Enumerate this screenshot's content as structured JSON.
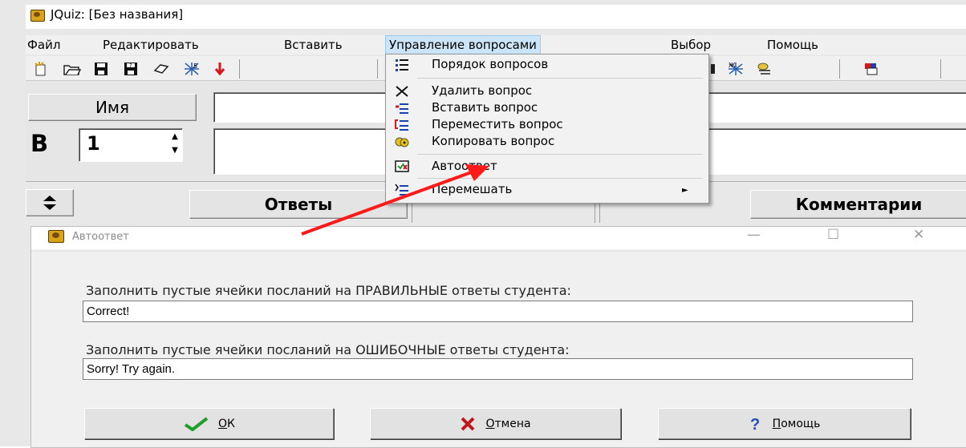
{
  "window": {
    "title": "JQuiz: [Без названия]"
  },
  "menubar": {
    "items": [
      "Файл",
      "Редактировать",
      "Вставить",
      "Управление вопросами",
      "Выбор",
      "Помощь"
    ]
  },
  "form": {
    "name_label": "Имя",
    "question_label": "В",
    "question_number": "1",
    "spin_up": "▲",
    "spin_down": "▼",
    "answers_label": "Ответы",
    "comments_label": "Комментарии"
  },
  "dropdown": {
    "items": [
      {
        "label": "Порядок вопросов",
        "icon": "list-order-icon"
      },
      {
        "label": "Удалить вопрос",
        "icon": "delete-x-icon"
      },
      {
        "label": "Вставить вопрос",
        "icon": "insert-question-icon"
      },
      {
        "label": "Переместить вопрос",
        "icon": "move-question-icon"
      },
      {
        "label": "Копировать вопрос",
        "icon": "copy-question-icon"
      },
      {
        "label": "Автоответ",
        "icon": "autoanswer-icon"
      },
      {
        "label": "Перемешать",
        "icon": "shuffle-icon",
        "submenu_arrow": "►"
      }
    ]
  },
  "dialog": {
    "title": "Автоответ",
    "minimize": "—",
    "maximize": "☐",
    "close": "✕",
    "correct_label": "Заполнить пустые ячейки посланий на ПРАВИЛЬНЫЕ ответы студента:",
    "correct_value": "Correct!",
    "wrong_label": "Заполнить пустые ячейки посланий на ОШИБОЧНЫЕ ответы студента:",
    "wrong_value": "Sorry! Try again.",
    "ok_accel": "О",
    "ok_rest": "К",
    "cancel_accel": "О",
    "cancel_rest": "тмена",
    "help_accel": "П",
    "help_rest": "омощь"
  },
  "colors": {
    "menu_highlight": "#cce4f7",
    "arrow": "#ff1a1a",
    "ok_check": "#1f9e2a",
    "cancel_x": "#c0161c",
    "help_q": "#1f4fc0"
  }
}
